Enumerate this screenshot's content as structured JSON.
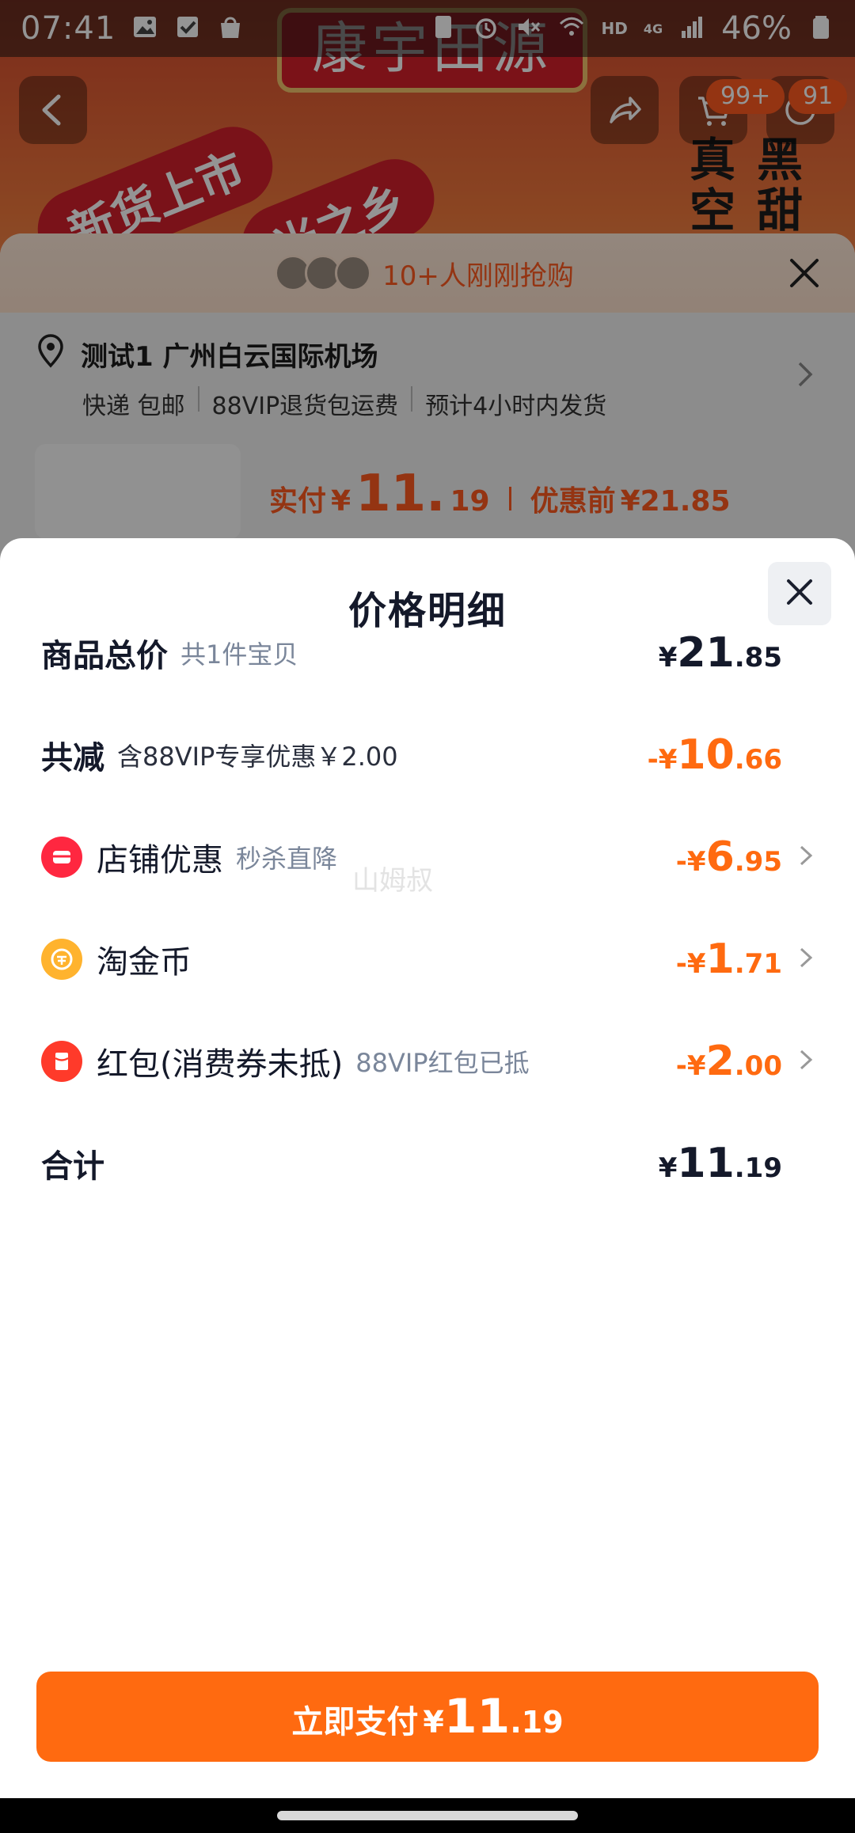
{
  "status_bar": {
    "time": "07:41",
    "battery": "46%",
    "network": "4G",
    "hd": "HD"
  },
  "background_page": {
    "banner_text": "康宇田源",
    "pill_1": "新货上市",
    "pill_2": "米之乡",
    "side_text_1": "真空",
    "side_text_2": "黑甜",
    "badge_cart": "99+",
    "badge_msg": "91"
  },
  "order_sheet": {
    "recent_buyers": "10+人刚刚抢购",
    "address": "测试1 广州白云国际机场",
    "tags": [
      "快递 包邮",
      "88VIP退货包运费",
      "预计4小时内发货"
    ],
    "pay_label": "实付",
    "pay_symbol": "¥",
    "pay_int": "11.",
    "pay_dec": "19",
    "before_label": "优惠前",
    "before_amount": "¥21.85"
  },
  "price_detail": {
    "title": "价格明细",
    "rows": [
      {
        "label": "商品总价",
        "sub": "共1件宝贝",
        "sign": "",
        "sym": "¥",
        "int": "21",
        "dec": ".85",
        "color": "#14192a"
      },
      {
        "label": "共减",
        "sub": "含88VIP专享优惠￥2.00",
        "sign": "-",
        "sym": "¥",
        "int": "10",
        "dec": ".66",
        "color": "#ff6a10"
      },
      {
        "label": "店铺优惠",
        "sub": "秒杀直降",
        "sign": "-",
        "sym": "¥",
        "int": "6",
        "dec": ".95",
        "icon": "store-icon"
      },
      {
        "label": "淘金币",
        "sub": "",
        "sign": "-",
        "sym": "¥",
        "int": "1",
        "dec": ".71",
        "icon": "coin-icon"
      },
      {
        "label": "红包(消费券未抵)",
        "sub": "88VIP红包已抵",
        "sign": "-",
        "sym": "¥",
        "int": "2",
        "dec": ".00",
        "icon": "red-packet-icon"
      },
      {
        "label": "合计",
        "sub": "",
        "sign": "",
        "sym": "¥",
        "int": "11",
        "dec": ".19"
      }
    ],
    "watermark": "山姆叔"
  },
  "pay_button": {
    "label": "立即支付",
    "sym": "¥",
    "int": "11",
    "dec": ".19"
  },
  "colors": {
    "accent": "#ff6a10",
    "text_dark": "#14192a",
    "text_muted": "#7a869a"
  }
}
